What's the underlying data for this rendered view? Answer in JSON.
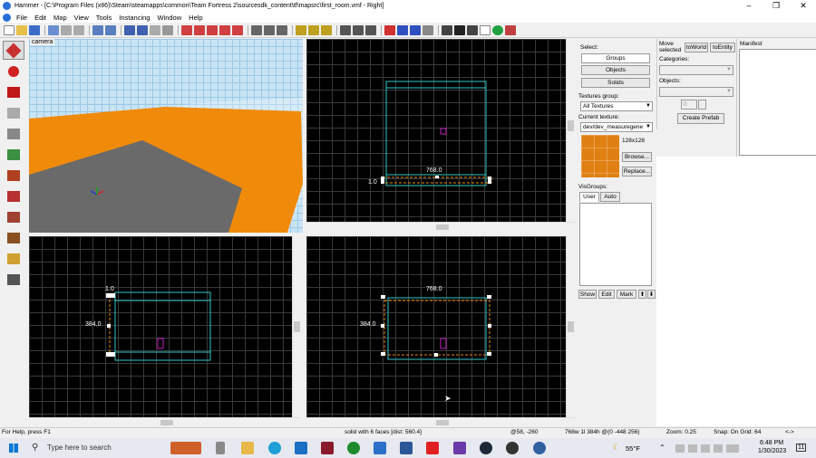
{
  "window": {
    "title": "Hammer - [C:\\Program Files (x86)\\Steam\\steamapps\\common\\Team Fortress 2\\sourcesdk_content\\tf\\mapsrc\\first_room.vmf - Right]",
    "minimize": "–",
    "maximize": "❐",
    "close": "✕"
  },
  "menu": [
    "File",
    "Edit",
    "Map",
    "View",
    "Tools",
    "Instancing",
    "Window",
    "Help"
  ],
  "viewports": {
    "camera_label": "camera",
    "top_right": {
      "width_label": "768.0",
      "height_label": "1.0"
    },
    "bottom_left": {
      "top_label": "1.0",
      "side_label": "384.0"
    },
    "bottom_right": {
      "top_label": "768.0",
      "side_label": "384.0"
    }
  },
  "right_panel": {
    "select_label": "Select:",
    "groups": "Groups",
    "objects": "Objects",
    "solids": "Solids",
    "textures_group_label": "Textures group:",
    "textures_group_value": "All Textures",
    "current_texture_label": "Current texture:",
    "current_texture_value": "dev/dev_measuregene",
    "texture_size": "128x128",
    "browse": "Browse...",
    "replace": "Replace...",
    "texture_color": "#e07f12",
    "visgroups_label": "VisGroups:",
    "tab_user": "User",
    "tab_auto": "Auto",
    "show": "Show",
    "edit": "Edit",
    "mark": "Mark",
    "up": "⬆",
    "down": "⬇"
  },
  "move_panel": {
    "move_selected": "Move selected",
    "to_world": "toWorld",
    "to_entity": "toEntity",
    "categories_label": "Categories:",
    "objects_label": "Objects:",
    "spin_value": "0",
    "create_prefab": "Create Prefab",
    "manifest": "Manifest"
  },
  "status": {
    "help": "For Help, press F1",
    "selection": "solid with 6 faces  [dist: 560.4]",
    "cursor": "@58, -260",
    "size": "768w 1l 384h @(0 -448 256)",
    "zoom": "Zoom: 0.25",
    "snap": "Snap: On Grid: 64",
    "extra": "<->"
  },
  "taskbar": {
    "search_placeholder": "Type here to search",
    "weather": "55°F",
    "time": "6:48 PM",
    "date": "1/30/2023",
    "notif": "11"
  },
  "colors": {
    "orange": "#f08a0a",
    "cyan": "#2ec8c8",
    "magenta": "#c020c0",
    "sky": "#c8e4f4"
  }
}
